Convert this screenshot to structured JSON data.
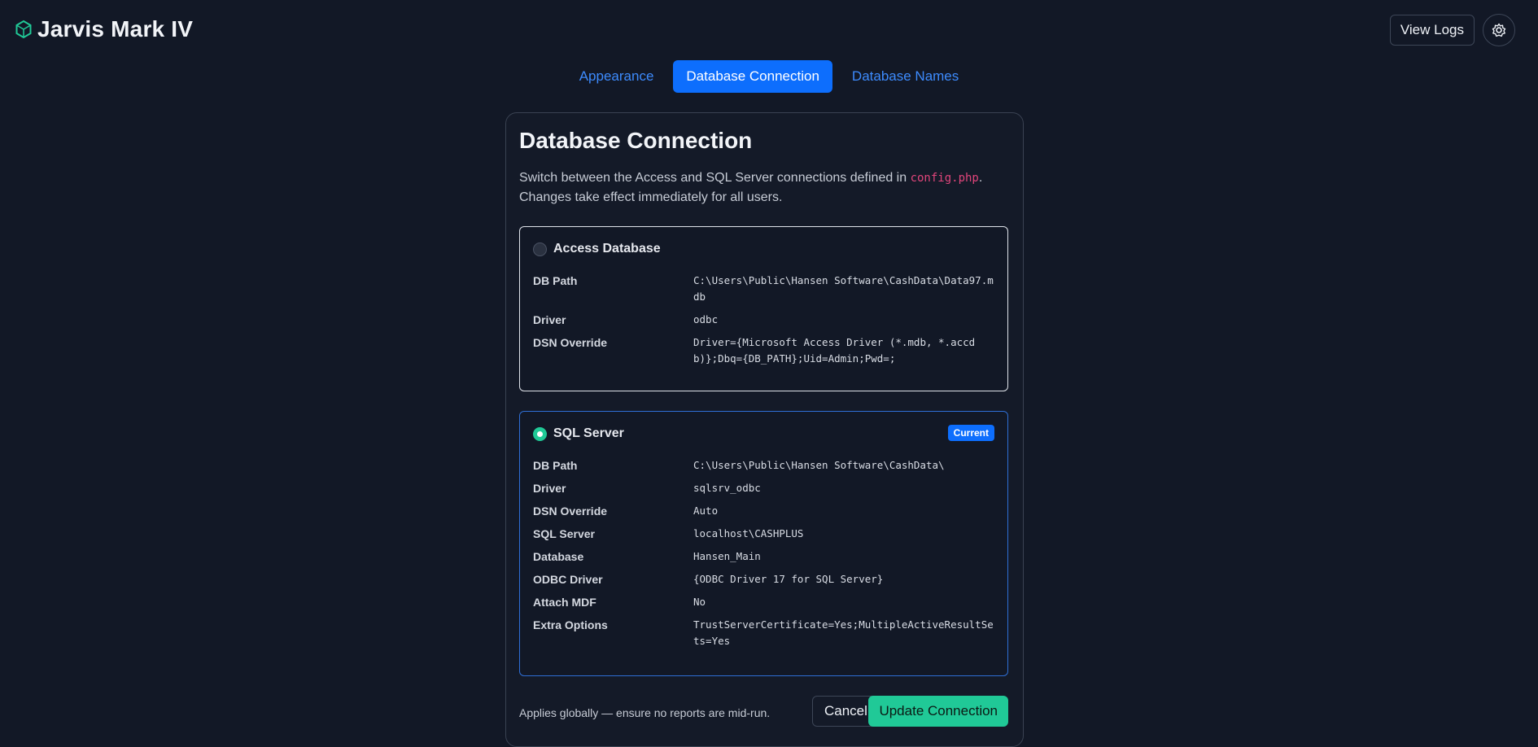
{
  "app": {
    "title": "Jarvis Mark IV",
    "accent": "#20c997",
    "primary": "#0d6efd"
  },
  "header": {
    "view_logs_label": "View Logs",
    "settings_icon": "gear-icon",
    "brand_icon": "hexagon-icon"
  },
  "tabs": [
    {
      "label": "Appearance",
      "active": false
    },
    {
      "label": "Database Connection",
      "active": true
    },
    {
      "label": "Database Names",
      "active": false
    }
  ],
  "card": {
    "title": "Database Connection",
    "desc_prefix": "Switch between the Access and SQL Server connections defined in ",
    "desc_code": "config.php",
    "desc_suffix": ".",
    "desc_line2": "Changes take effect immediately for all users."
  },
  "access": {
    "label": "Access Database",
    "selected": false,
    "rows": [
      {
        "label": "DB Path",
        "value": "C:\\Users\\Public\\Hansen Software\\CashData\\Data97.mdb"
      },
      {
        "label": "Driver",
        "value": "odbc"
      },
      {
        "label": "DSN Override",
        "value": "Driver={Microsoft Access Driver (*.mdb, *.accdb)};Dbq={DB_PATH};Uid=Admin;Pwd=;"
      }
    ]
  },
  "sql": {
    "label": "SQL Server",
    "selected": true,
    "badge": "Current",
    "rows": [
      {
        "label": "DB Path",
        "value": "C:\\Users\\Public\\Hansen Software\\CashData\\"
      },
      {
        "label": "Driver",
        "value": "sqlsrv_odbc"
      },
      {
        "label": "DSN Override",
        "value": "Auto"
      },
      {
        "label": "SQL Server",
        "value": "localhost\\CASHPLUS"
      },
      {
        "label": "Database",
        "value": "Hansen_Main"
      },
      {
        "label": "ODBC Driver",
        "value": "{ODBC Driver 17 for SQL Server}"
      },
      {
        "label": "Attach MDF",
        "value": "No"
      },
      {
        "label": "Extra Options",
        "value": "TrustServerCertificate=Yes;MultipleActiveResultSets=Yes"
      }
    ]
  },
  "footer": {
    "note": "Applies globally — ensure no reports are mid-run.",
    "cancel_label": "Cancel",
    "update_label": "Update Connection"
  }
}
